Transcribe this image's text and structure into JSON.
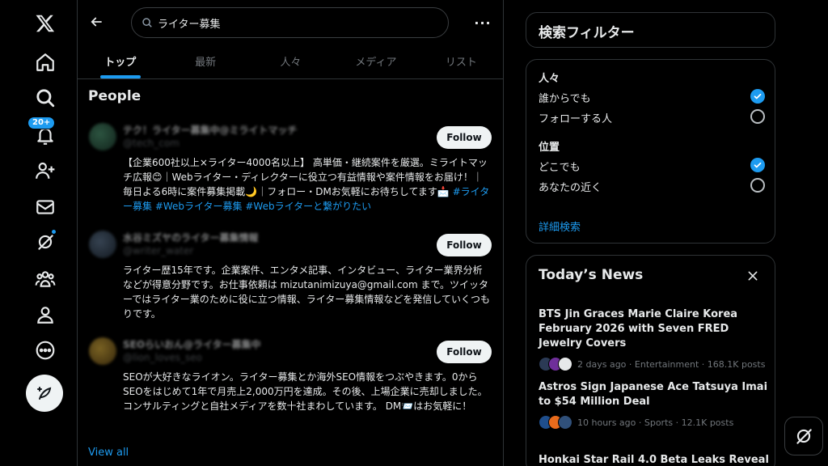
{
  "nav": {
    "notifications_badge": "20+"
  },
  "search": {
    "query": "ライター募集"
  },
  "tabs": [
    {
      "label": "トップ"
    },
    {
      "label": "最新"
    },
    {
      "label": "人々"
    },
    {
      "label": "メディア"
    },
    {
      "label": "リスト"
    }
  ],
  "people": {
    "title": "People",
    "follow_label": "Follow",
    "items": [
      {
        "name": "テク！ライター募集中@ミライトマッチ",
        "handle": "@tech_com",
        "bio_text": "【企業600社以上×ライター4000名以上】 高単価・継続案件を厳選。ミライトマッチ広報😊｜Webライター・ディレクターに役立つ有益情報や案件情報をお届け！｜毎日よる6時に案件募集掲載🌙｜フォロー・DMお気軽にお待ちしてます📩",
        "bio_tags": "#ライター募集 #Webライター募集 #Webライターと繋がりたい"
      },
      {
        "name": "水谷ミズヤのライター募集情報",
        "handle": "@writer_water",
        "bio_text": "ライター歴15年です。企業案件、エンタメ記事、インタビュー、ライター業界分析などが得意分野です。お仕事依頼は mizutanimizuya@gmail.com まで。ツイッターではライター業のために役に立つ情報、ライター募集情報などを発信していくつもりです。",
        "bio_tags": ""
      },
      {
        "name": "SEOらいおん@ライター募集中",
        "handle": "@lion_loves_seo",
        "bio_text": "SEOが大好きなライオン。ライター募集とか海外SEO情報をつぶやきます。0からSEOをはじめて1年で月売上2,000万円を達成。その後、上場企業に売却しました。コンサルティングと自社メディアを数十社まわしています。 DM📨はお気軽に！",
        "bio_tags": ""
      }
    ],
    "view_all": "View all"
  },
  "filters": {
    "title": "検索フィルター",
    "people_label": "人々",
    "people_options": [
      {
        "label": "誰からでも",
        "checked": true
      },
      {
        "label": "フォローする人",
        "checked": false
      }
    ],
    "location_label": "位置",
    "location_options": [
      {
        "label": "どこでも",
        "checked": true
      },
      {
        "label": "あなたの近く",
        "checked": false
      }
    ],
    "advanced": "詳細検索"
  },
  "news": {
    "title": "Today’s News",
    "items": [
      {
        "title": "BTS Jin Graces Marie Claire Korea February 2026 with Seven FRED Jewelry Covers",
        "meta": "2 days ago · Entertainment · 168.1K posts"
      },
      {
        "title": "Astros Sign Japanese Ace Tatsuya Imai to $54 Million Deal",
        "meta": "10 hours ago · Sports · 12.1K posts"
      },
      {
        "title": "Honkai Star Rail 4.0 Beta Leaks Reveal",
        "meta": ""
      }
    ]
  },
  "colors": {
    "accent": "#1d9bf0",
    "background": "#000000",
    "border": "#2f3336",
    "muted_text": "#71767b"
  }
}
